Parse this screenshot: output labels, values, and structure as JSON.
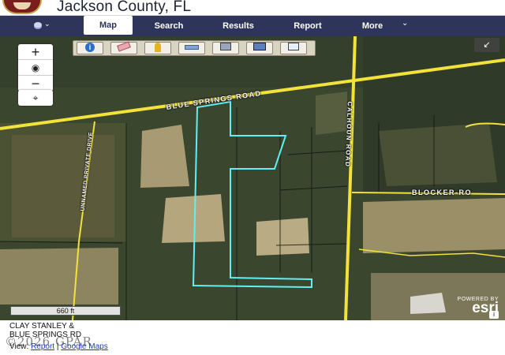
{
  "header": {
    "title": "Jackson County, FL"
  },
  "nav": {
    "items": [
      {
        "label": "Map",
        "active": true
      },
      {
        "label": "Search"
      },
      {
        "label": "Results"
      },
      {
        "label": "Report"
      },
      {
        "label": "More"
      }
    ]
  },
  "map": {
    "toolbar": {
      "tools": [
        "info-icon",
        "eraser-icon",
        "pin-icon",
        "measure-icon",
        "print-icon",
        "query-icon",
        "export-icon"
      ]
    },
    "road_labels": {
      "blue_springs": "BLUE SPRINGS ROAD",
      "calhoun": "CALHOUN ROAD",
      "blocker": "BLOCKER-RO",
      "private_drive": "UNNAMED PRIVATE DRIVE"
    },
    "scale": "660 ft",
    "attribution": {
      "powered": "POWERED BY",
      "brand": "esri"
    },
    "colors": {
      "parcel_outline": "#5ff0f2",
      "road": "#f2e23a",
      "nav": "#2f355a"
    }
  },
  "footer": {
    "owner": "CLAY STANLEY &",
    "address": "BLUE SPRINGS RD",
    "watermark": "©2026 GPAR",
    "view_label": "View:",
    "report_link": "Report",
    "separator": "|",
    "google_link": "Google Maps"
  }
}
